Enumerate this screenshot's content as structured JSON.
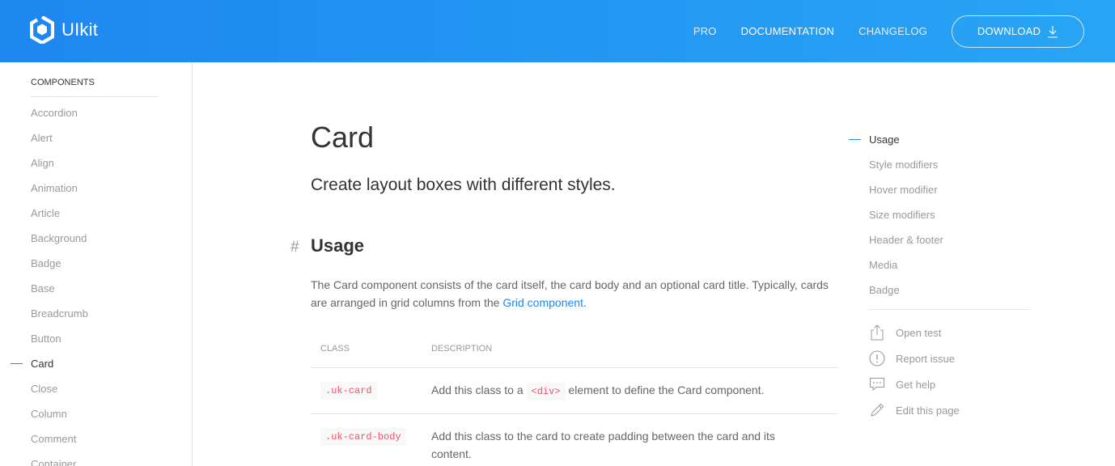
{
  "brand": {
    "name": "UIkit"
  },
  "nav": {
    "links": [
      "PRO",
      "DOCUMENTATION",
      "CHANGELOG"
    ],
    "download_label": "DOWNLOAD"
  },
  "sidebar": {
    "header": "COMPONENTS",
    "items": [
      "Accordion",
      "Alert",
      "Align",
      "Animation",
      "Article",
      "Background",
      "Badge",
      "Base",
      "Breadcrumb",
      "Button",
      "Card",
      "Close",
      "Column",
      "Comment",
      "Container"
    ],
    "active": "Card"
  },
  "main": {
    "title": "Card",
    "lead": "Create layout boxes with different styles.",
    "section": {
      "hash": "#",
      "title": "Usage"
    },
    "paragraph_text": "The Card component consists of the card itself, the card body and an optional card title. Typically, cards are arranged in grid columns from the ",
    "paragraph_link": "Grid component",
    "paragraph_end": ".",
    "table": {
      "headers": [
        "CLASS",
        "DESCRIPTION"
      ],
      "rows": [
        {
          "class": ".uk-card",
          "desc_pre": "Add this class to a ",
          "desc_code": "<div>",
          "desc_post": " element to define the Card component."
        },
        {
          "class": ".uk-card-body",
          "desc_pre": "Add this class to the card to create padding between the card and its content.",
          "desc_code": "",
          "desc_post": ""
        }
      ]
    }
  },
  "toc": {
    "items": [
      "Usage",
      "Style modifiers",
      "Hover modifier",
      "Size modifiers",
      "Header & footer",
      "Media",
      "Badge"
    ],
    "active": "Usage",
    "utilities": [
      {
        "label": "Open test",
        "icon": "share-icon"
      },
      {
        "label": "Report issue",
        "icon": "warning-icon"
      },
      {
        "label": "Get help",
        "icon": "comment-icon"
      },
      {
        "label": "Edit this page",
        "icon": "pencil-icon"
      }
    ]
  },
  "colors": {
    "primary": "#1e87f0",
    "code": "#f0506e"
  }
}
